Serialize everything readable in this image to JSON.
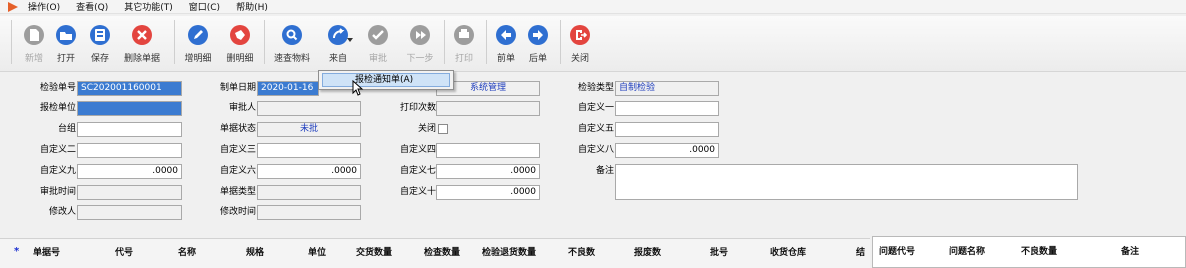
{
  "menu": {
    "items": [
      "操作(O)",
      "查看(Q)",
      "其它功能(T)",
      "窗口(C)",
      "帮助(H)"
    ]
  },
  "toolbar": {
    "new": "新增",
    "open": "打开",
    "save": "保存",
    "delete_doc": "删除单据",
    "add_detail": "增明细",
    "delete_detail": "删明细",
    "quick_material": "速查物料",
    "from": "来自",
    "approve": "审批",
    "next_step": "下一步",
    "print": "打印",
    "prev_doc": "前单",
    "next_doc": "后单",
    "close": "关闭"
  },
  "popup": {
    "item": "报检通知单(A)"
  },
  "form": {
    "inspect_no_label": "检验单号",
    "inspect_no": "SC202001160001",
    "report_unit_label": "报检单位",
    "report_unit": "",
    "group_label": "台组",
    "group": "",
    "custom2_label": "自定义二",
    "custom2": "",
    "custom9_label": "自定义九",
    "custom9": ".0000",
    "approve_time_label": "审批时间",
    "approve_time": "",
    "modifier_label": "修改人",
    "modifier": "",
    "made_date_label": "制单日期",
    "made_date": "2020-01-16",
    "approver_label": "审批人",
    "approver": "",
    "doc_status_label": "单据状态",
    "doc_status": "未批",
    "custom3_label": "自定义三",
    "custom3": "",
    "custom6_label": "自定义六",
    "custom6": ".0000",
    "doc_type_label": "单据类型",
    "doc_type": "",
    "modify_time_label": "修改时间",
    "modify_time": "",
    "maker": "系统管理",
    "print_count_label": "打印次数",
    "print_count": "",
    "closed_label": "关闭",
    "custom4_label": "自定义四",
    "custom4": "",
    "custom7_label": "自定义七",
    "custom7": ".0000",
    "custom10_label": "自定义十",
    "custom10": ".0000",
    "inspect_type_label": "检验类型",
    "inspect_type": "自制检验",
    "custom1_label": "自定义一",
    "custom1": "",
    "custom5_label": "自定义五",
    "custom5": "",
    "custom8_label": "自定义八",
    "custom8": ".0000",
    "remark_label": "备注",
    "remark": ""
  },
  "grid": {
    "marker": "*",
    "columns": [
      "单据号",
      "代号",
      "名称",
      "规格",
      "单位",
      "交货数量",
      "检查数量",
      "检验退货数量",
      "不良数",
      "报废数",
      "批号",
      "收货仓库",
      "结"
    ]
  },
  "subgrid": {
    "columns": [
      "问题代号",
      "问题名称",
      "不良数量",
      "备注"
    ]
  },
  "colors": {
    "accent_blue": "#2f6fd1",
    "delete_red": "#e3453f",
    "selection": "#3b7bd1",
    "link_text": "#1e3dbd"
  }
}
